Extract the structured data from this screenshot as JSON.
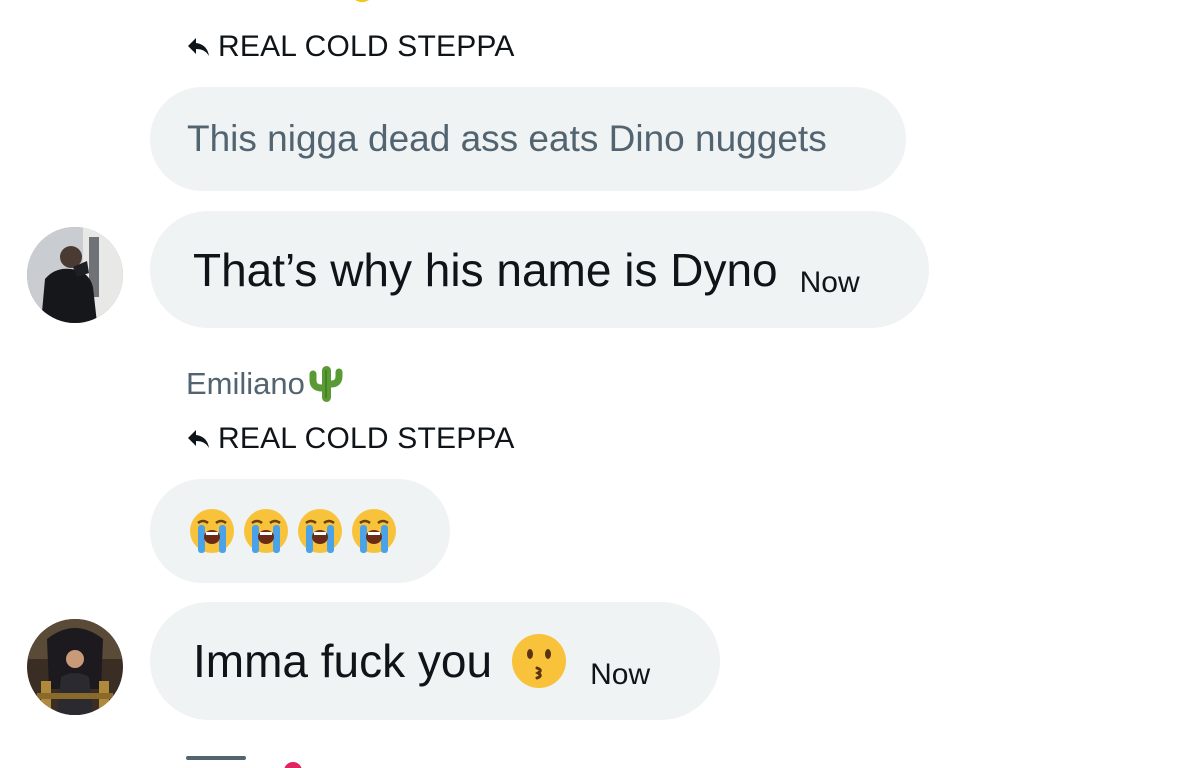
{
  "conversation": {
    "reply_context_1": {
      "reply_icon": "reply-arrow-icon",
      "replying_to": "REAL COLD STEPPA"
    },
    "quoted_message": {
      "text": "This nigga dead ass eats Dino nuggets"
    },
    "message_1": {
      "text": "That’s why his name is Dyno",
      "time": "Now",
      "avatar": "user-avatar-photo"
    },
    "sender_2": {
      "name": "Emiliano",
      "emoji": "cactus-emoji"
    },
    "reply_context_2": {
      "reply_icon": "reply-arrow-icon",
      "replying_to": "REAL COLD STEPPA"
    },
    "emoji_message": {
      "emojis": [
        "loudly-crying-face",
        "loudly-crying-face",
        "loudly-crying-face",
        "loudly-crying-face"
      ]
    },
    "message_2": {
      "text": "Imma fuck you",
      "emoji": "kissing-face",
      "time": "Now",
      "avatar": "user-avatar-photo-chair"
    }
  },
  "colors": {
    "bubble_bg": "#eff3f4",
    "secondary_text": "#536471",
    "primary_text": "#0f1419"
  }
}
